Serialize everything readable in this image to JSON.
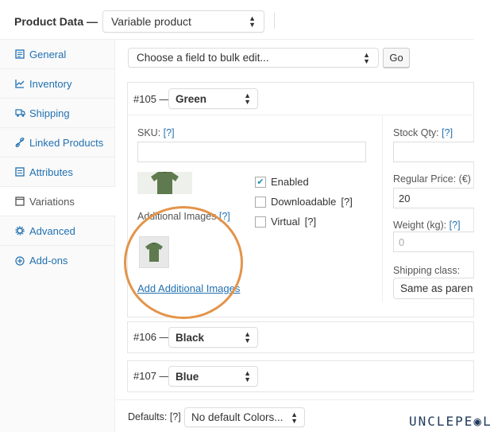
{
  "header": {
    "product_data_label": "Product Data —",
    "product_type_value": "Variable product"
  },
  "sidebar": {
    "items": [
      {
        "label": "General",
        "icon": "general-icon"
      },
      {
        "label": "Inventory",
        "icon": "inventory-icon"
      },
      {
        "label": "Shipping",
        "icon": "shipping-icon"
      },
      {
        "label": "Linked Products",
        "icon": "link-icon"
      },
      {
        "label": "Attributes",
        "icon": "attributes-icon"
      },
      {
        "label": "Variations",
        "icon": "variations-icon"
      },
      {
        "label": "Advanced",
        "icon": "gear-icon"
      },
      {
        "label": "Add-ons",
        "icon": "add-icon"
      }
    ]
  },
  "bulk": {
    "select_value": "Choose a field to bulk edit...",
    "go_label": "Go"
  },
  "variations": [
    {
      "id": "#105 —",
      "value": "Green"
    },
    {
      "id": "#106 —",
      "value": "Black"
    },
    {
      "id": "#107 —",
      "value": "Blue"
    }
  ],
  "variation_detail": {
    "sku_label": "SKU:",
    "help": "[?]",
    "enabled_label": "Enabled",
    "downloadable_label": "Downloadable",
    "virtual_label": "Virtual",
    "additional_images_label": "Additional Images",
    "add_images_link": "Add Additional Images",
    "stock_qty_label": "Stock Qty:",
    "regular_price_label": "Regular Price: (€)",
    "regular_price_value": "20",
    "weight_label": "Weight (kg):",
    "weight_placeholder": "0",
    "shipping_class_label": "Shipping class:",
    "shipping_class_value": "Same as paren"
  },
  "defaults": {
    "label": "Defaults:",
    "help": "[?]",
    "value": "No default Colors..."
  },
  "watermark": "UNCLEPE◉L",
  "colors": {
    "accent": "#2271b1",
    "highlight_circle": "#e3944a",
    "shirt": "#5e7a4e"
  }
}
